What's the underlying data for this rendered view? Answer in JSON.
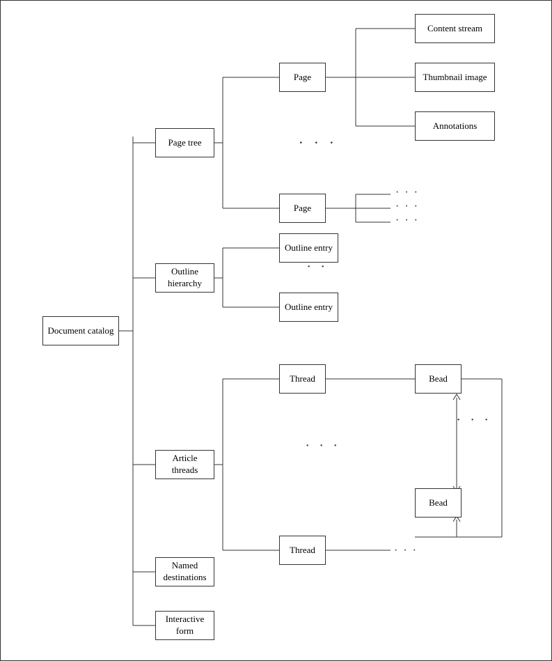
{
  "nodes": {
    "document_catalog": {
      "label": "Document catalog"
    },
    "page_tree": {
      "label": "Page tree"
    },
    "page1": {
      "label": "Page"
    },
    "page2": {
      "label": "Page"
    },
    "content_stream": {
      "label": "Content stream"
    },
    "thumbnail_image": {
      "label": "Thumbnail image"
    },
    "annotations": {
      "label": "Annotations"
    },
    "outline_hierarchy": {
      "label": "Outline hierarchy"
    },
    "outline_entry1": {
      "label": "Outline entry"
    },
    "outline_entry2": {
      "label": "Outline entry"
    },
    "article_threads": {
      "label": "Article threads"
    },
    "thread1": {
      "label": "Thread"
    },
    "thread2": {
      "label": "Thread"
    },
    "bead1": {
      "label": "Bead"
    },
    "bead2": {
      "label": "Bead"
    },
    "named_destinations": {
      "label": "Named destinations"
    },
    "interactive_form": {
      "label": "Interactive form"
    }
  },
  "dots": {
    "three_dots": "· · ·",
    "two_dots": "· ·"
  },
  "colors": {
    "border": "#333",
    "bg": "#fff"
  }
}
